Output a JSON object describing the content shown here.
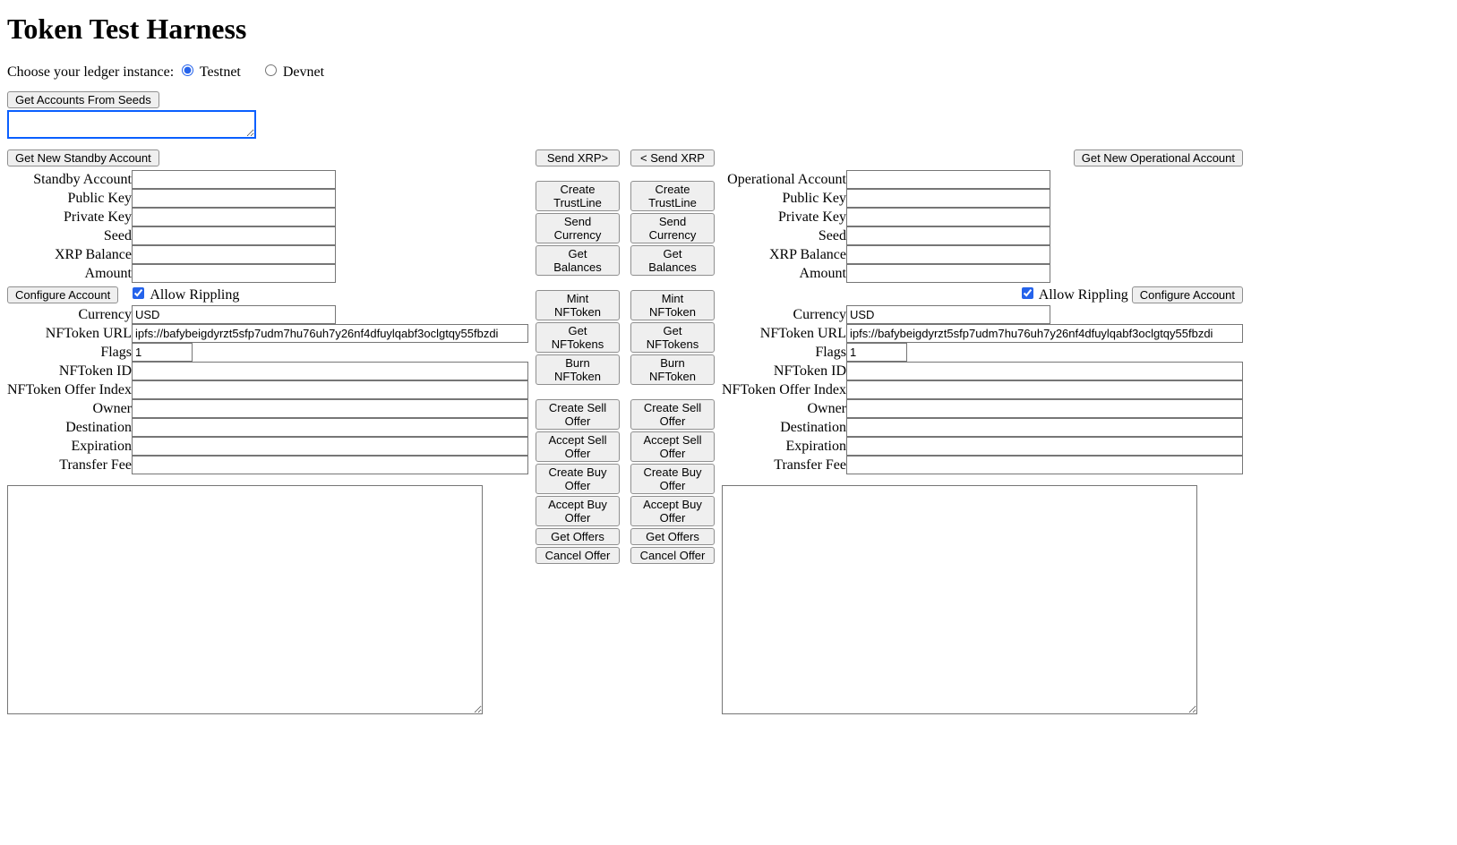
{
  "title": "Token Test Harness",
  "ledger_label": "Choose your ledger instance:",
  "ledger_options": {
    "testnet": "Testnet",
    "devnet": "Devnet"
  },
  "ledger_selected": "testnet",
  "get_accounts_from_seeds": "Get Accounts From Seeds",
  "seeds_value": "",
  "standby": {
    "get_new_btn": "Get New Standby Account",
    "labels": {
      "account": "Standby Account",
      "public_key": "Public Key",
      "private_key": "Private Key",
      "seed": "Seed",
      "xrp_balance": "XRP Balance",
      "amount": "Amount",
      "currency": "Currency",
      "nftoken_url": "NFToken URL",
      "flags": "Flags",
      "nftoken_id": "NFToken ID",
      "nftoken_offer_index": "NFToken Offer Index",
      "owner": "Owner",
      "destination": "Destination",
      "expiration": "Expiration",
      "transfer_fee": "Transfer Fee"
    },
    "values": {
      "account": "",
      "public_key": "",
      "private_key": "",
      "seed": "",
      "xrp_balance": "",
      "amount": "",
      "currency": "USD",
      "nftoken_url": "ipfs://bafybeigdyrzt5sfp7udm7hu76uh7y26nf4dfuylqabf3oclgtqy55fbzdi",
      "flags": "1",
      "nftoken_id": "",
      "nftoken_offer_index": "",
      "owner": "",
      "destination": "",
      "expiration": "",
      "transfer_fee": ""
    },
    "configure_btn": "Configure Account",
    "allow_rippling": "Allow Rippling",
    "allow_rippling_checked": true
  },
  "operational": {
    "get_new_btn": "Get New Operational Account",
    "labels": {
      "account": "Operational Account",
      "public_key": "Public Key",
      "private_key": "Private Key",
      "seed": "Seed",
      "xrp_balance": "XRP Balance",
      "amount": "Amount",
      "currency": "Currency",
      "nftoken_url": "NFToken URL",
      "flags": "Flags",
      "nftoken_id": "NFToken ID",
      "nftoken_offer_index": "NFToken Offer Index",
      "owner": "Owner",
      "destination": "Destination",
      "expiration": "Expiration",
      "transfer_fee": "Transfer Fee"
    },
    "values": {
      "account": "",
      "public_key": "",
      "private_key": "",
      "seed": "",
      "xrp_balance": "",
      "amount": "",
      "currency": "USD",
      "nftoken_url": "ipfs://bafybeigdyrzt5sfp7udm7hu76uh7y26nf4dfuylqabf3oclgtqy55fbzdi",
      "flags": "1",
      "nftoken_id": "",
      "nftoken_offer_index": "",
      "owner": "",
      "destination": "",
      "expiration": "",
      "transfer_fee": ""
    },
    "configure_btn": "Configure Account",
    "allow_rippling": "Allow Rippling",
    "allow_rippling_checked": true
  },
  "mid": {
    "send_xrp_right": "Send XRP>",
    "send_xrp_left": "< Send XRP",
    "create_trustline": "Create TrustLine",
    "send_currency": "Send Currency",
    "get_balances": "Get Balances",
    "mint_nftoken": "Mint NFToken",
    "get_nftokens": "Get NFTokens",
    "burn_nftoken": "Burn NFToken",
    "create_sell_offer": "Create Sell Offer",
    "accept_sell_offer": "Accept Sell Offer",
    "create_buy_offer": "Create Buy Offer",
    "accept_buy_offer": "Accept Buy Offer",
    "get_offers": "Get Offers",
    "cancel_offer": "Cancel Offer"
  }
}
